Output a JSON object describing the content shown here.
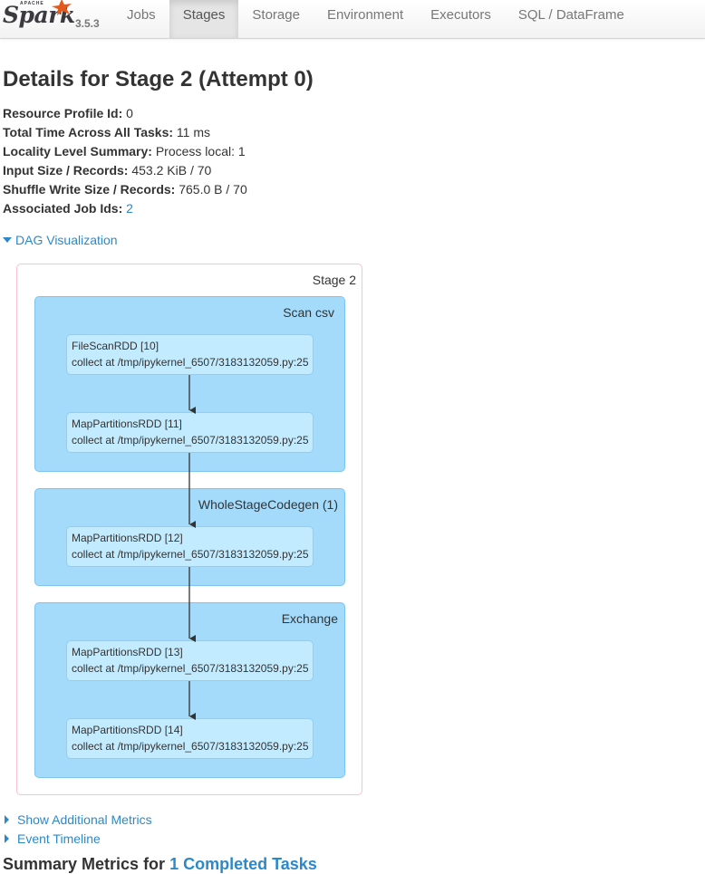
{
  "brand": {
    "apache": "APACHE",
    "name": "Spark",
    "version": "3.5.3"
  },
  "nav": {
    "tabs": [
      {
        "label": "Jobs"
      },
      {
        "label": "Stages"
      },
      {
        "label": "Storage"
      },
      {
        "label": "Environment"
      },
      {
        "label": "Executors"
      },
      {
        "label": "SQL / DataFrame"
      }
    ],
    "active": "Stages"
  },
  "page": {
    "title": "Details for Stage 2 (Attempt 0)"
  },
  "summary": {
    "resource_profile_label": "Resource Profile Id:",
    "resource_profile_value": "0",
    "total_time_label": "Total Time Across All Tasks:",
    "total_time_value": "11 ms",
    "locality_label": "Locality Level Summary:",
    "locality_value": "Process local: 1",
    "input_label": "Input Size / Records:",
    "input_value": "453.2 KiB / 70",
    "shuffle_label": "Shuffle Write Size / Records:",
    "shuffle_value": "765.0 B / 70",
    "job_ids_label": "Associated Job Ids:",
    "job_ids_value": "2"
  },
  "dag": {
    "toggle_label": "DAG Visualization",
    "stage_label": "Stage 2",
    "clusters": [
      {
        "label": "Scan csv"
      },
      {
        "label": "WholeStageCodegen (1)"
      },
      {
        "label": "Exchange"
      }
    ],
    "nodes": [
      {
        "name": "FileScanRDD [10]",
        "callsite": "collect at /tmp/ipykernel_6507/3183132059.py:25"
      },
      {
        "name": "MapPartitionsRDD [11]",
        "callsite": "collect at /tmp/ipykernel_6507/3183132059.py:25"
      },
      {
        "name": "MapPartitionsRDD [12]",
        "callsite": "collect at /tmp/ipykernel_6507/3183132059.py:25"
      },
      {
        "name": "MapPartitionsRDD [13]",
        "callsite": "collect at /tmp/ipykernel_6507/3183132059.py:25"
      },
      {
        "name": "MapPartitionsRDD [14]",
        "callsite": "collect at /tmp/ipykernel_6507/3183132059.py:25"
      }
    ]
  },
  "links": {
    "additional_metrics": "Show Additional Metrics",
    "event_timeline": "Event Timeline"
  },
  "summary_metrics": {
    "prefix": "Summary Metrics for ",
    "link": "1 Completed Tasks"
  },
  "colors": {
    "link": "#2c89c9",
    "cluster_fill": "#a4dbfb",
    "node_fill": "#c2ebff",
    "stage_border": "#f8c2cf"
  }
}
